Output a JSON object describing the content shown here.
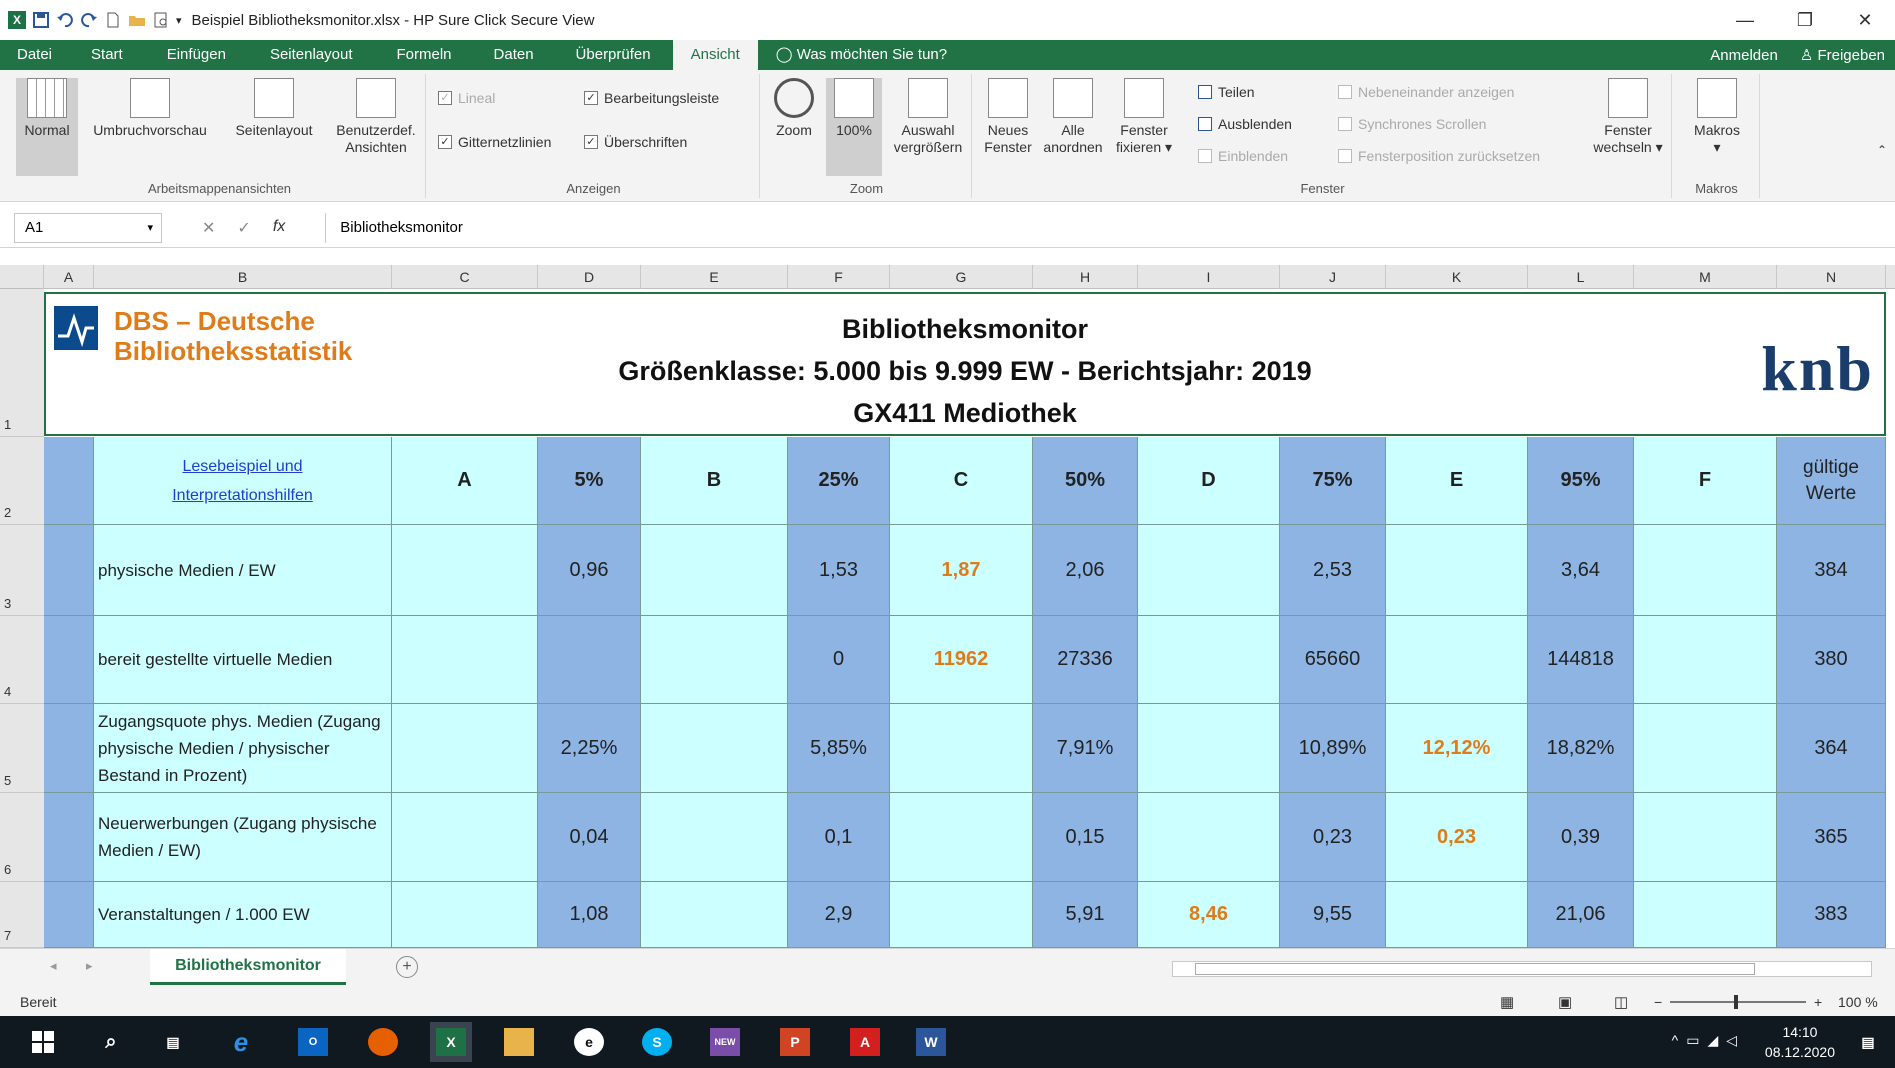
{
  "window": {
    "title": "Beispiel Bibliotheksmonitor.xlsx - HP Sure Click Secure View"
  },
  "tabs": [
    "Datei",
    "Start",
    "Einfügen",
    "Seitenlayout",
    "Formeln",
    "Daten",
    "Überprüfen",
    "Ansicht"
  ],
  "tell_me": "Was möchten Sie tun?",
  "account": {
    "signin": "Anmelden",
    "share": "Freigeben"
  },
  "ribbon": {
    "arbeitsmappen": {
      "label": "Arbeitsmappenansichten",
      "normal": "Normal",
      "umbruch": "Umbruchvorschau",
      "seitenlayout": "Seitenlayout",
      "benutzer1": "Benutzerdef.",
      "benutzer2": "Ansichten"
    },
    "anzeigen": {
      "label": "Anzeigen",
      "lineal": "Lineal",
      "bearbeitungsleiste": "Bearbeitungsleiste",
      "gitternetzlinien": "Gitternetzlinien",
      "ueberschriften": "Überschriften"
    },
    "zoom": {
      "label": "Zoom",
      "zoom": "Zoom",
      "hundert": "100%",
      "auswahl1": "Auswahl",
      "auswahl2": "vergrößern"
    },
    "fenster": {
      "label": "Fenster",
      "neues1": "Neues",
      "neues2": "Fenster",
      "alle1": "Alle",
      "alle2": "anordnen",
      "fixieren1": "Fenster",
      "fixieren2": "fixieren",
      "teilen": "Teilen",
      "ausblenden": "Ausblenden",
      "einblenden": "Einblenden",
      "nebeneinander": "Nebeneinander anzeigen",
      "synchron": "Synchrones Scrollen",
      "position": "Fensterposition zurücksetzen",
      "wechseln1": "Fenster",
      "wechseln2": "wechseln"
    },
    "makros": {
      "label": "Makros",
      "makros": "Makros"
    }
  },
  "formula_bar": {
    "cell": "A1",
    "value": "Bibliotheksmonitor"
  },
  "columns": [
    "A",
    "B",
    "C",
    "D",
    "E",
    "F",
    "G",
    "H",
    "I",
    "J",
    "K",
    "L",
    "M",
    "N"
  ],
  "banner": {
    "org1": "DBS – Deutsche",
    "org2": "Bibliotheksstatistik",
    "title1": "Bibliotheksmonitor",
    "title2": "Größenklasse: 5.000 bis 9.999 EW - Berichtsjahr: 2019",
    "title3": "GX411 Mediothek",
    "logo": "knb"
  },
  "table": {
    "link1": "Lesebeispiel und",
    "link2": "Interpretationshilfen",
    "headers": [
      "A",
      "5%",
      "B",
      "25%",
      "C",
      "50%",
      "D",
      "75%",
      "E",
      "95%",
      "F",
      "gültige Werte"
    ],
    "rows": [
      {
        "num": "3",
        "label": "physische Medien / EW",
        "vals": [
          "",
          "0,96",
          "",
          "1,53",
          "1,87",
          "2,06",
          "",
          "2,53",
          "",
          "3,64",
          "",
          "384"
        ]
      },
      {
        "num": "4",
        "label": "bereit gestellte virtuelle Medien",
        "vals": [
          "",
          "",
          "",
          "0",
          "11962",
          "27336",
          "",
          "65660",
          "",
          "144818",
          "",
          "380"
        ]
      },
      {
        "num": "5",
        "label": "Zugangsquote phys. Medien (Zugang physische Medien / physischer Bestand in Prozent)",
        "vals": [
          "",
          "2,25%",
          "",
          "5,85%",
          "",
          "7,91%",
          "",
          "10,89%",
          "12,12%",
          "18,82%",
          "",
          "364"
        ]
      },
      {
        "num": "6",
        "label": "Neuerwerbungen (Zugang physische Medien / EW)",
        "vals": [
          "",
          "0,04",
          "",
          "0,1",
          "",
          "0,15",
          "",
          "0,23",
          "0,23",
          "0,39",
          "",
          "365"
        ]
      },
      {
        "num": "7",
        "label": "Veranstaltungen / 1.000 EW",
        "vals": [
          "",
          "1,08",
          "",
          "2,9",
          "",
          "5,91",
          "8,46",
          "9,55",
          "",
          "21,06",
          "",
          "383"
        ]
      }
    ]
  },
  "sheet_tab": "Bibliotheksmonitor",
  "status": {
    "ready": "Bereit",
    "zoom": "100 %"
  },
  "clock": {
    "time": "14:10",
    "date": "08.12.2020"
  }
}
